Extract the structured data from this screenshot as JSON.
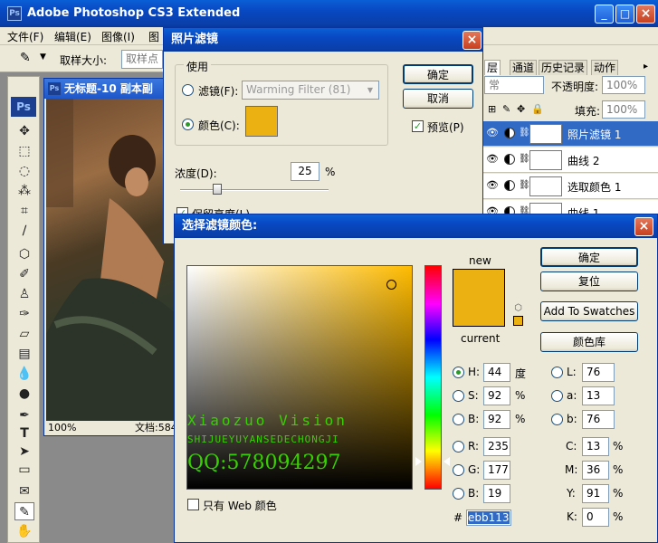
{
  "app": {
    "title": "Adobe Photoshop CS3 Extended",
    "menu": [
      "文件(F)",
      "编辑(E)",
      "图像(I)",
      "图"
    ]
  },
  "options_bar": {
    "sample_size_label": "取样大小:",
    "sample_size_value": "取样点"
  },
  "document": {
    "title": "无标题-10 副本副",
    "zoom": "100%",
    "status": "文档:584"
  },
  "layers_panel": {
    "tabs": [
      "层",
      "通道",
      "历史记录",
      "动作"
    ],
    "blend_mode": "常",
    "opacity_label": "不透明度:",
    "opacity_value": "100%",
    "fill_label": "填充:",
    "fill_value": "100%",
    "layers": [
      {
        "name": "照片滤镜 1",
        "selected": true
      },
      {
        "name": "曲线 2",
        "selected": false
      },
      {
        "name": "选取颜色 1",
        "selected": false
      },
      {
        "name": "曲线 1",
        "selected": false
      }
    ]
  },
  "photo_filter": {
    "title": "照片滤镜",
    "use_label": "使用",
    "filter_label": "滤镜(F):",
    "filter_value": "Warming Filter (81)",
    "color_label": "颜色(C):",
    "swatch_color": "#ebb113",
    "ok_label": "确定",
    "cancel_label": "取消",
    "preview_label": "预览(P)",
    "density_label": "浓度(D):",
    "density_value": "25",
    "density_unit": "%",
    "density_level": 0.25,
    "preserve_label": "保留亮度(L)"
  },
  "picker": {
    "title": "选择滤镜颜色:",
    "new_label": "new",
    "current_label": "current",
    "new_color": "#ebb113",
    "ok_label": "确定",
    "reset_label": "复位",
    "add_swatches_label": "Add To Swatches",
    "libraries_label": "颜色库",
    "fields": {
      "H": {
        "label": "H:",
        "value": "44",
        "unit": "度"
      },
      "S": {
        "label": "S:",
        "value": "92",
        "unit": "%"
      },
      "B": {
        "label": "B:",
        "value": "92",
        "unit": "%"
      },
      "R": {
        "label": "R:",
        "value": "235"
      },
      "G": {
        "label": "G:",
        "value": "177"
      },
      "Bl": {
        "label": "B:",
        "value": "19"
      },
      "L": {
        "label": "L:",
        "value": "76"
      },
      "a": {
        "label": "a:",
        "value": "13"
      },
      "b": {
        "label": "b:",
        "value": "76"
      },
      "C": {
        "label": "C:",
        "value": "13",
        "unit": "%"
      },
      "M": {
        "label": "M:",
        "value": "36",
        "unit": "%"
      },
      "Y": {
        "label": "Y:",
        "value": "91",
        "unit": "%"
      },
      "K": {
        "label": "K:",
        "value": "0",
        "unit": "%"
      }
    },
    "hex_label": "#",
    "hex_value": "ebb113",
    "web_only_label": "只有 Web 颜色",
    "watermark": {
      "line1": "Xiaozuo Vision",
      "line2": "SHIJUEYUYANSEDECHONGJI",
      "line3": "QQ:578094297"
    }
  }
}
